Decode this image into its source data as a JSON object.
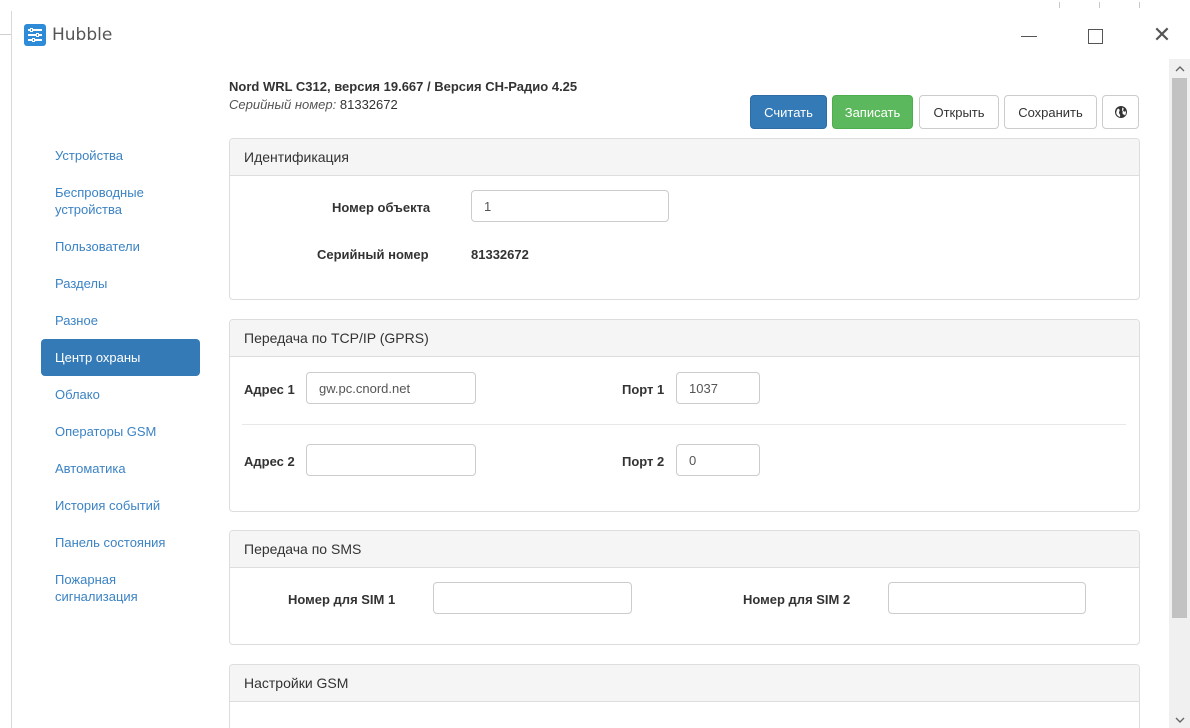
{
  "window": {
    "title": "Hubble",
    "close_glyph": "✕"
  },
  "header": {
    "device_title": "Nord WRL C312, версия 19.667 / Версия СН-Радио 4.25",
    "serial_label": "Серийный номер:",
    "serial_value": "81332672"
  },
  "toolbar": {
    "read_label": "Считать",
    "write_label": "Записать",
    "open_label": "Открыть",
    "save_label": "Сохранить",
    "globe_icon": "globe-icon"
  },
  "sidebar": {
    "items": [
      {
        "label": "Устройства"
      },
      {
        "label": "Беспроводные устройства"
      },
      {
        "label": "Пользователи"
      },
      {
        "label": "Разделы"
      },
      {
        "label": "Разное"
      },
      {
        "label": "Центр охраны",
        "active": true
      },
      {
        "label": "Облако"
      },
      {
        "label": "Операторы GSM"
      },
      {
        "label": "Автоматика"
      },
      {
        "label": "История событий"
      },
      {
        "label": "Панель состояния"
      },
      {
        "label": "Пожарная сигнализация"
      }
    ]
  },
  "identification": {
    "title": "Идентификация",
    "object_number_label": "Номер объекта",
    "object_number_value": "1",
    "serial_label": "Серийный номер",
    "serial_value": "81332672"
  },
  "tcpip": {
    "title": "Передача по TCP/IP (GPRS)",
    "address1_label": "Адрес 1",
    "address1_value": "gw.pc.cnord.net",
    "port1_label": "Порт 1",
    "port1_value": "1037",
    "address2_label": "Адрес 2",
    "address2_value": "",
    "port2_label": "Порт 2",
    "port2_value": "0"
  },
  "sms": {
    "title": "Передача по SMS",
    "sim1_label": "Номер для SIM 1",
    "sim1_value": "",
    "sim2_label": "Номер для SIM 2",
    "sim2_value": ""
  },
  "gsm": {
    "title": "Настройки GSM"
  },
  "colors": {
    "primary": "#337ab7",
    "success": "#5cb85c",
    "link": "#3b83c4",
    "panel_heading": "#f5f5f5"
  }
}
